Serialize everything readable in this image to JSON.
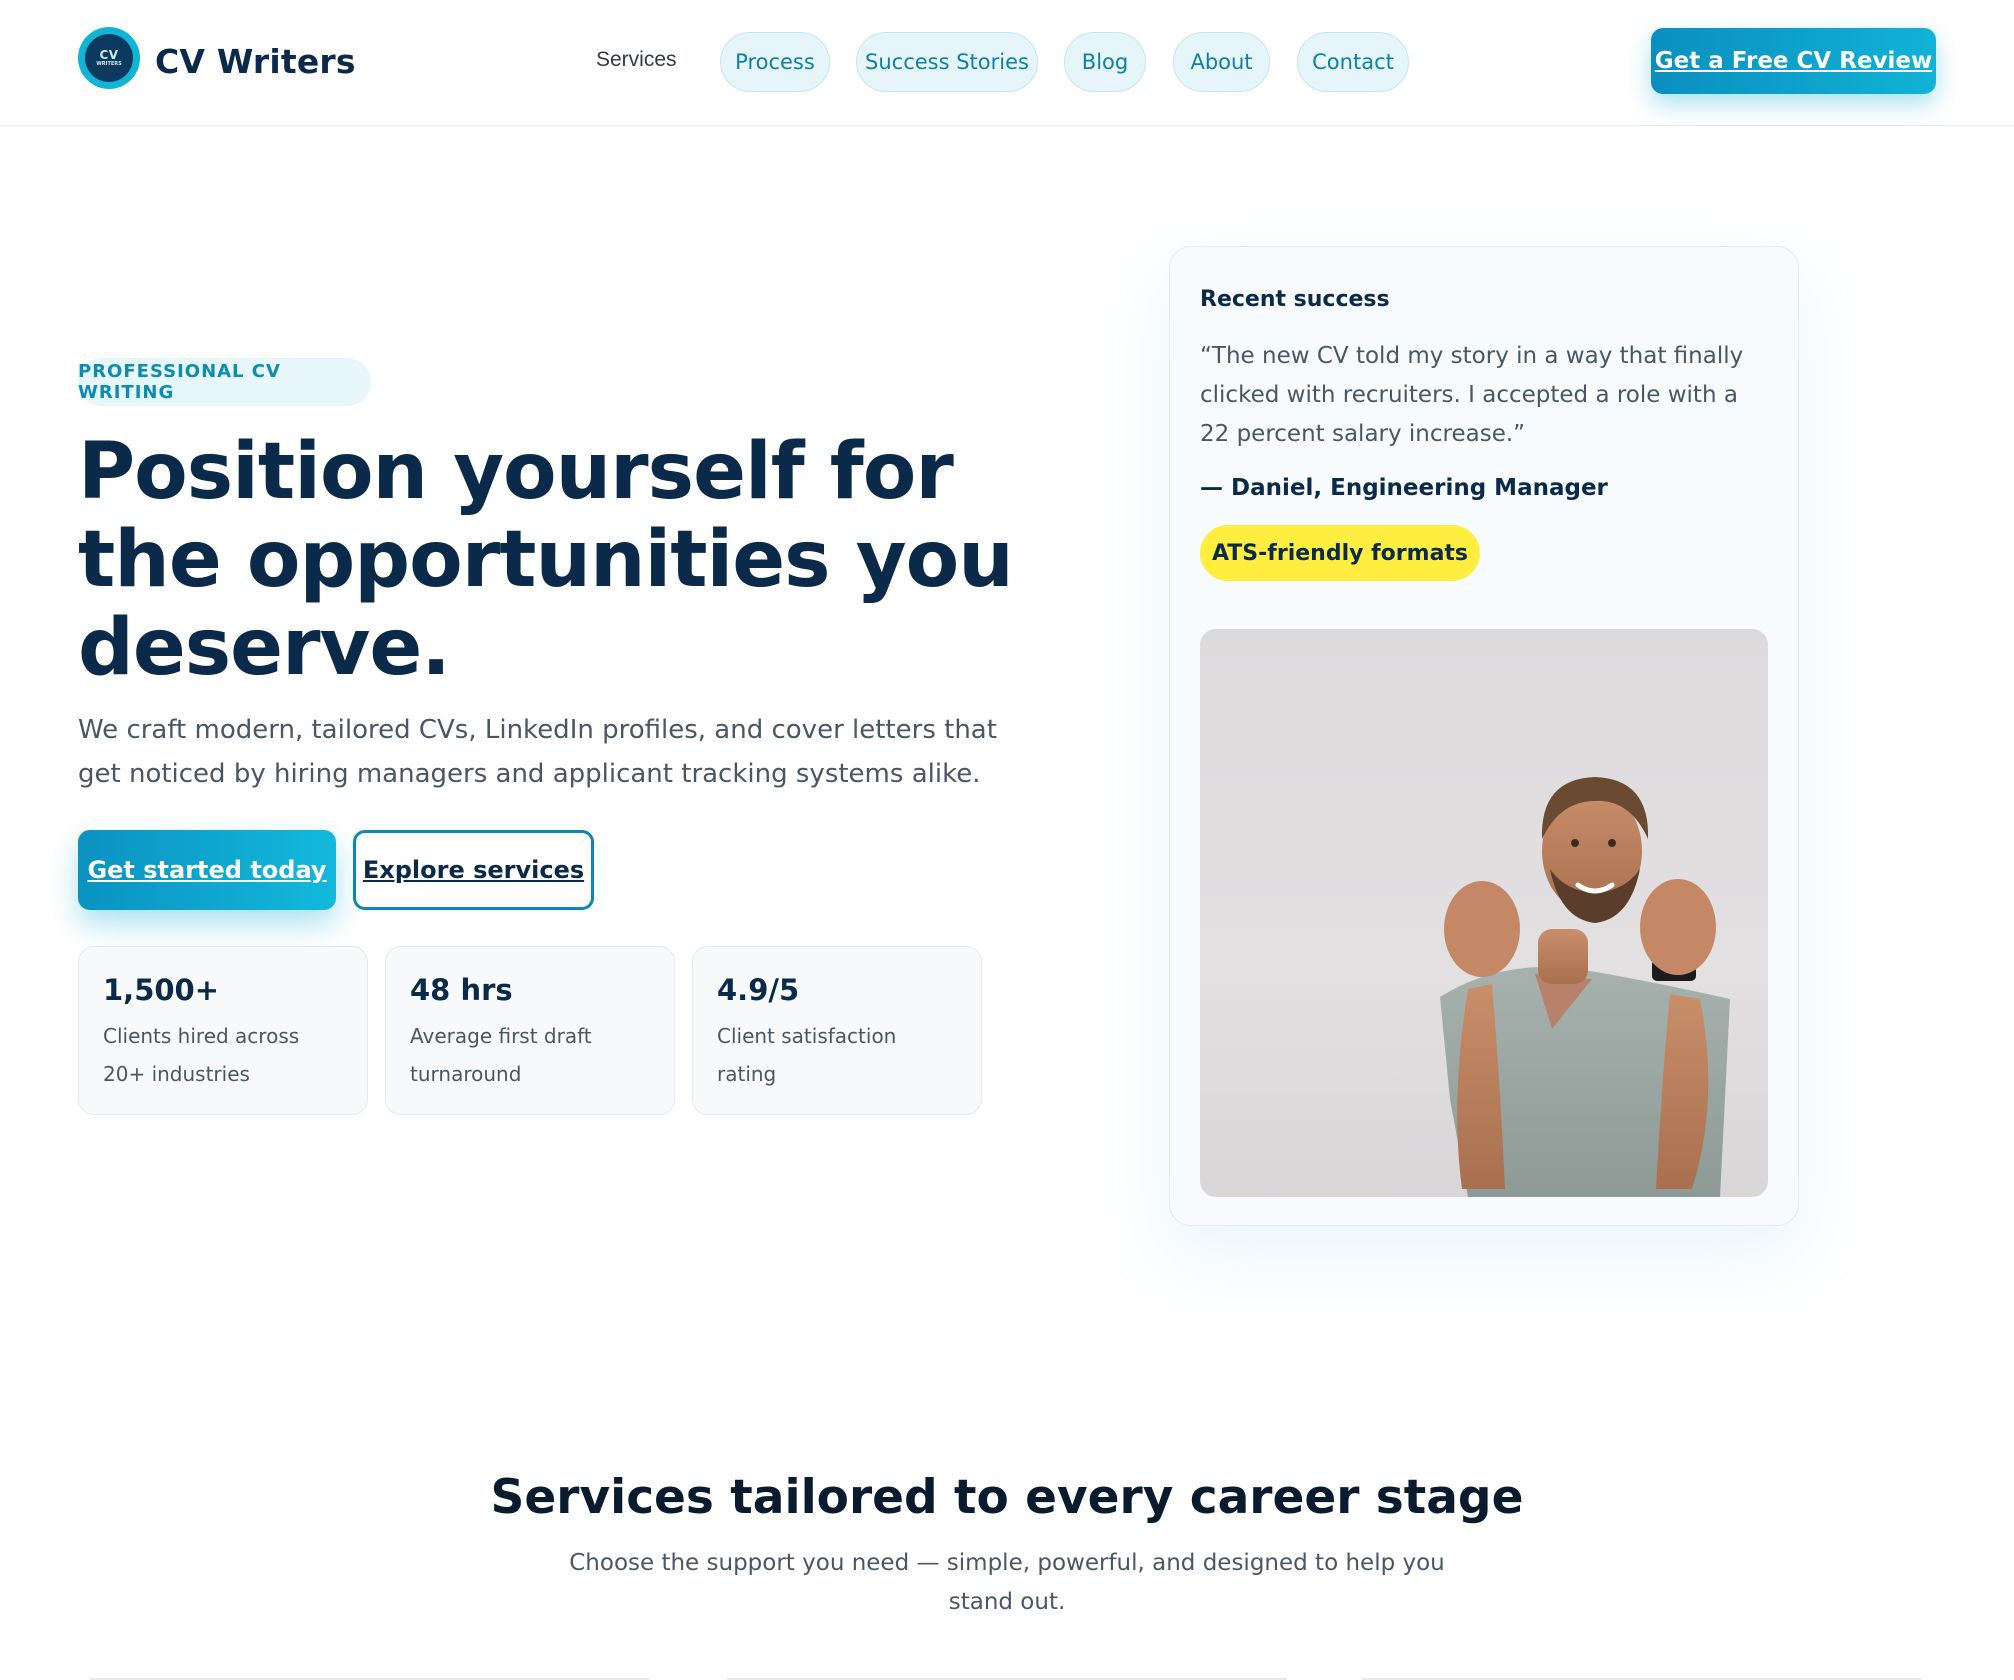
{
  "header": {
    "logo_line1": "CV",
    "logo_line2": "WRITERS",
    "brand": "CV Writers",
    "nav": {
      "services": "Services",
      "process": "Process",
      "success_stories": "Success Stories",
      "blog": "Blog",
      "about": "About",
      "contact": "Contact"
    },
    "cta": "Get a Free CV Review"
  },
  "hero": {
    "eyebrow": "PROFESSIONAL CV WRITING",
    "title": "Position yourself for the opportunities you deserve.",
    "subtitle": "We craft modern, tailored CVs, LinkedIn profiles, and cover letters that get noticed by hiring managers and applicant tracking systems alike.",
    "primary_button": "Get started today",
    "secondary_button": "Explore services",
    "stats": [
      {
        "value": "1,500+",
        "label": "Clients hired across 20+ industries"
      },
      {
        "value": "48 hrs",
        "label": "Average first draft turnaround"
      },
      {
        "value": "4.9/5",
        "label": "Client satisfaction rating"
      }
    ]
  },
  "testimonial": {
    "heading": "Recent success",
    "quote": "“The new CV told my story in a way that finally clicked with recruiters. I accepted a role with a 22 percent salary increase.”",
    "author": "— Daniel, Engineering Manager",
    "badge": "ATS-friendly formats"
  },
  "services": {
    "title": "Services tailored to every career stage",
    "subtitle": "Choose the support you need — simple, powerful, and designed to help you stand out."
  },
  "colors": {
    "navy": "#0b2a4a",
    "accent": "#10b3d6",
    "pill_bg": "#e6f5f9",
    "badge_yellow": "#ffee3f"
  }
}
